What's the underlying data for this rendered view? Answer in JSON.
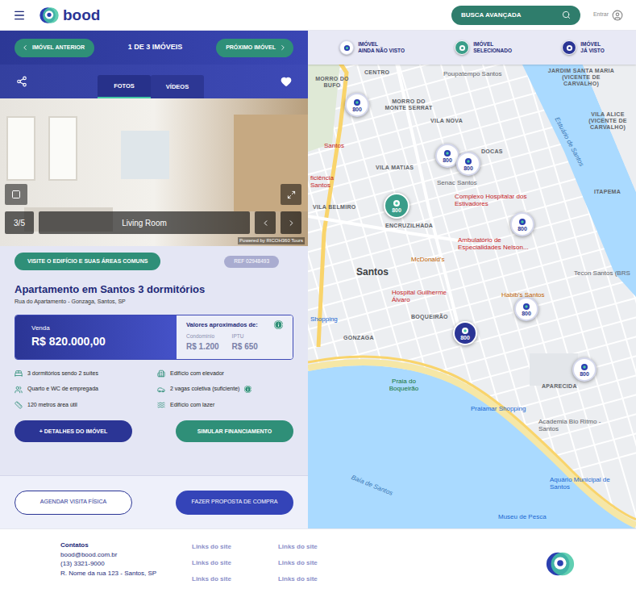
{
  "header": {
    "logo": "bood",
    "search_button": "BUSCA AVANÇADA",
    "login": "Entrar"
  },
  "listing_nav": {
    "previous": "IMÓVEL ANTERIOR",
    "counter": "1 DE 3 IMÓVEIS",
    "next": "PRÓXIMO IMÓVEL"
  },
  "media": {
    "tabs": [
      {
        "label": "FOTOS",
        "selected": true
      },
      {
        "label": "VÍDEOS",
        "selected": false
      }
    ],
    "favorite": true,
    "photo_counter": "3/5",
    "photo_caption": "Living Room",
    "credit": "Powered by RICOH360 Tours"
  },
  "building_tour_button": "VISITE O EDIFÍCIO E SUAS ÁREAS COMUNS",
  "reference": "REF 02948493",
  "listing": {
    "title": "Apartamento em Santos 3 dormitórios",
    "address": "Rua do Apartamento - Gonzaga, Santos, SP"
  },
  "price": {
    "label": "Venda",
    "value": "R$ 820.000,00",
    "approx_title": "Valores aproximados de:",
    "fees": [
      {
        "label": "Condomínio",
        "value": "R$ 1.200"
      },
      {
        "label": "IPTU",
        "value": "R$ 650"
      }
    ]
  },
  "features": [
    {
      "text": "3 dormitórios sendo 2 suítes",
      "kind": "plain"
    },
    {
      "text": "Edifício com elevador",
      "kind": "plain"
    },
    {
      "text": "Quarto e WC de empregada",
      "kind": "plain"
    },
    {
      "text": "2 vagas coletiva (suficiente)",
      "kind": "with-info"
    },
    {
      "text": "120 metros área útil",
      "kind": "plain"
    },
    {
      "text": "Edifício com lazer",
      "kind": "plain"
    }
  ],
  "actions": {
    "details": "+ DETALHES DO IMÓVEL",
    "simulate": "SIMULAR FINANCIAMENTO",
    "schedule": "AGENDAR VISITA FÍSICA",
    "proposal": "FAZER PROPOSTA DE COMPRA"
  },
  "map": {
    "legend": [
      {
        "kind": "unseen",
        "lines": [
          "IMÓVEL",
          "AINDA NÃO VISTO"
        ]
      },
      {
        "kind": "selected",
        "lines": [
          "IMÓVEL",
          "SELECIONADO"
        ]
      },
      {
        "kind": "seen",
        "lines": [
          "IMÓVEL",
          "JÁ VISTO"
        ]
      }
    ],
    "pins": [
      {
        "label": "800",
        "kind": "unseen"
      },
      {
        "label": "800",
        "kind": "unseen"
      },
      {
        "label": "800",
        "kind": "unseen"
      },
      {
        "label": "800",
        "kind": "selected"
      },
      {
        "label": "800",
        "kind": "unseen"
      },
      {
        "label": "800",
        "kind": "unseen"
      },
      {
        "label": "800",
        "kind": "seen"
      },
      {
        "label": "800",
        "kind": "unseen"
      }
    ],
    "labels": [
      {
        "text": "CENTRO",
        "kind": "district"
      },
      {
        "text": "Poupatempo Santos",
        "kind": "place"
      },
      {
        "text": "MORRO DO BUFO",
        "kind": "district"
      },
      {
        "text": "MORRO DO MONTE SERRAT",
        "kind": "district"
      },
      {
        "text": "VILA NOVA",
        "kind": "district"
      },
      {
        "text": "DOCAS",
        "kind": "district"
      },
      {
        "text": "Santos",
        "kind": "health"
      },
      {
        "text": "VILA MATIAS",
        "kind": "district"
      },
      {
        "text": "Senac Santos",
        "kind": "place"
      },
      {
        "text": "ficiência Santos",
        "kind": "health"
      },
      {
        "text": "VILA BELMIRO",
        "kind": "district"
      },
      {
        "text": "Complexo Hospitalar dos Estivadores",
        "kind": "health"
      },
      {
        "text": "ENCRUZILHADA",
        "kind": "district"
      },
      {
        "text": "Ambulatório de Especialidades Nelson...",
        "kind": "health"
      },
      {
        "text": "McDonald's",
        "kind": "food"
      },
      {
        "text": "Santos",
        "kind": "city"
      },
      {
        "text": "Hospital Guilherme Álvaro",
        "kind": "health"
      },
      {
        "text": "Habib's Santos",
        "kind": "food"
      },
      {
        "text": "BOQUEIRÃO",
        "kind": "district"
      },
      {
        "text": "Shopping",
        "kind": "shop"
      },
      {
        "text": "GONZAGA",
        "kind": "district"
      },
      {
        "text": "APARECIDA",
        "kind": "district"
      },
      {
        "text": "Praia do Boqueirão",
        "kind": "park"
      },
      {
        "text": "Praiamar Shopping",
        "kind": "shop"
      },
      {
        "text": "Academia Bio Ritmo - Santos",
        "kind": "place"
      },
      {
        "text": "Aquário Municipal de Santos",
        "kind": "shop"
      },
      {
        "text": "Baía de Santos",
        "kind": "water"
      },
      {
        "text": "Museu de Pesca",
        "kind": "shop"
      },
      {
        "text": "Estuário de Santos",
        "kind": "water"
      },
      {
        "text": "JARDIM SANTA MARIA (VICENTE DE CARVALHO)",
        "kind": "district"
      },
      {
        "text": "VILA ALICE (VICENTE DE CARVALHO)",
        "kind": "district"
      },
      {
        "text": "ITAPEMA",
        "kind": "district"
      },
      {
        "text": "Tecon Santos (BRS",
        "kind": "place"
      }
    ]
  },
  "footer": {
    "contacts_title": "Contatos",
    "email": "bood@bood.com.br",
    "phone": "(13) 3321-9000",
    "address": "R. Nome da rua 123 - Santos, SP",
    "link_columns": [
      [
        "Links do site",
        "Links do site",
        "Links do site"
      ],
      [
        "Links do site",
        "Links do site",
        "Links do site"
      ]
    ]
  }
}
